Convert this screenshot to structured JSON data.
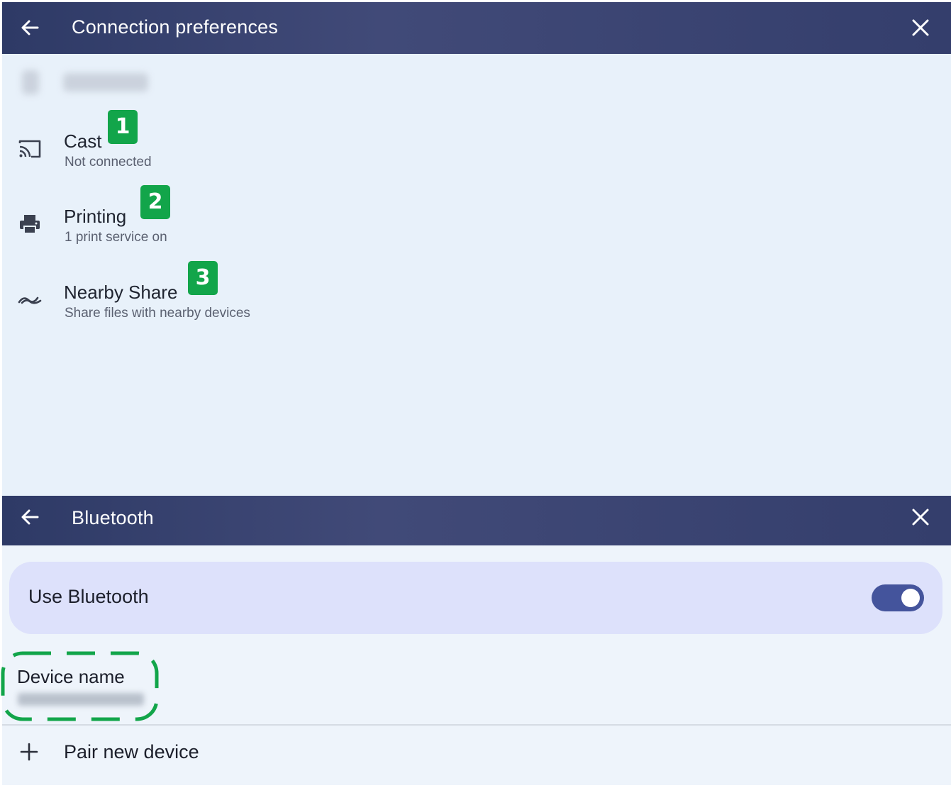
{
  "connection_panel": {
    "title": "Connection preferences",
    "back_icon": "arrow-left-icon",
    "close_icon": "close-icon",
    "items": [
      {
        "title": "Cast",
        "subtitle": "Not connected",
        "icon": "cast-icon",
        "badge": "1"
      },
      {
        "title": "Printing",
        "subtitle": "1 print service on",
        "icon": "printer-icon",
        "badge": "2"
      },
      {
        "title": "Nearby Share",
        "subtitle": "Share files with nearby devices",
        "icon": "nearby-share-icon",
        "badge": "3"
      }
    ]
  },
  "bluetooth_panel": {
    "title": "Bluetooth",
    "back_icon": "arrow-left-icon",
    "close_icon": "close-icon",
    "use_bluetooth_label": "Use Bluetooth",
    "use_bluetooth_on": true,
    "device_name_label": "Device name",
    "pair_new_device_label": "Pair new device",
    "pair_icon": "plus-icon"
  },
  "colors": {
    "header": "#363f6e",
    "panel_bg": "#e8f1fa",
    "badge": "#12a54a",
    "highlight_outline": "#12a54a",
    "toggle_on": "#44549c",
    "card_bg": "#dde1fb"
  }
}
